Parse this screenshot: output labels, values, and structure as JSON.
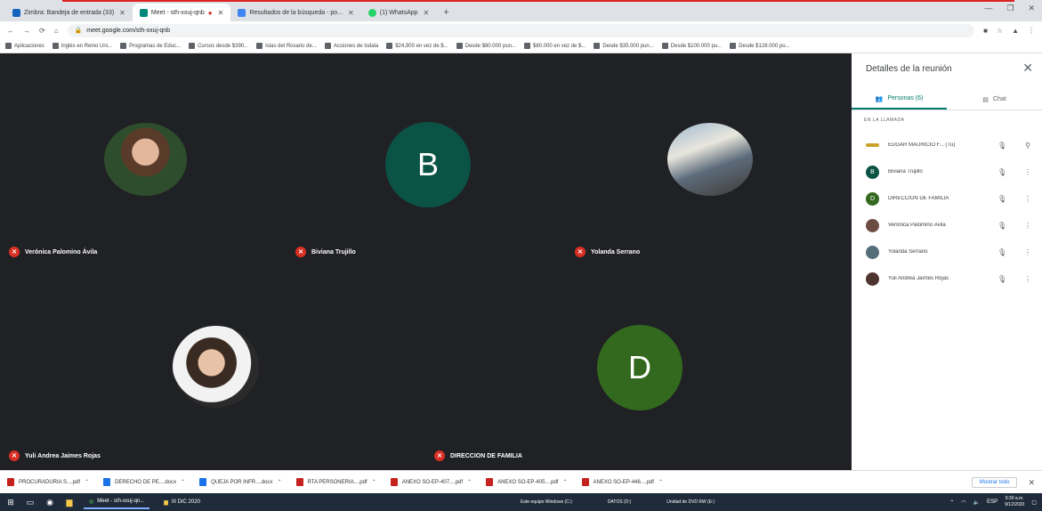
{
  "browser": {
    "tabs": [
      {
        "label": "Zimbra: Bandeja de entrada (33)",
        "active": false
      },
      {
        "label": "Meet - sth-xxuj-qnb",
        "active": true
      },
      {
        "label": "Resultados de la búsqueda - po...",
        "active": false
      },
      {
        "label": "(1) WhatsApp",
        "active": false
      }
    ],
    "new_tab": "+",
    "url": "meet.google.com/sth-xxuj-qnb",
    "bookmarks": [
      "Aplicaciones",
      "Inglés en Reino Uni...",
      "Programas de Educ...",
      "Cursos desde $390...",
      "Islas del Rosario de...",
      "Acciones de Isdala",
      "$24,900 en vez de $...",
      "Desde $80.000 pun...",
      "$80.000 en vez de $...",
      "Desde $35.000 pun...",
      "Desde $100.000 pu...",
      "Desde $128.000 pu..."
    ]
  },
  "meet": {
    "participants": [
      {
        "name": "Verónica Palomino Ávila",
        "kind": "photo",
        "photo": "photo1"
      },
      {
        "name": "Biviana Trujillo",
        "kind": "initial",
        "initial": "B",
        "color": "#0b5345"
      },
      {
        "name": "Yolanda Serrano",
        "kind": "photo",
        "photo": "photo2"
      },
      {
        "name": "Yuli Andrea Jaimes Rojas",
        "kind": "photo",
        "photo": "photo3"
      },
      {
        "name": "DIRECCION DE FAMILIA",
        "kind": "initial",
        "initial": "D",
        "color": "#33691e"
      }
    ]
  },
  "panel": {
    "title": "Detalles de la reunión",
    "tab_people": "Personas (6)",
    "tab_chat": "Chat",
    "section": "EN LA LLAMADA",
    "people": [
      {
        "name": "EDGAR MAURICIO F... (Tú)",
        "initial": "",
        "color": "#c9a227",
        "host": true
      },
      {
        "name": "Biviana Trujillo",
        "initial": "B",
        "color": "#0b5345"
      },
      {
        "name": "DIRECCION DE FAMILIA",
        "initial": "D",
        "color": "#33691e"
      },
      {
        "name": "Verónica Palomino Ávila",
        "initial": "",
        "color": "#6d4c41"
      },
      {
        "name": "Yolanda Serrano",
        "initial": "",
        "color": "#546e7a"
      },
      {
        "name": "Yuli Andrea Jaimes Rojas",
        "initial": "",
        "color": "#4e342e"
      }
    ]
  },
  "downloads": {
    "items": [
      {
        "name": "PROCURADURIA S....pdf",
        "type": "pdf"
      },
      {
        "name": "DERECHO DE PE....docx",
        "type": "doc"
      },
      {
        "name": "QUEJA POR INFR....docx",
        "type": "doc"
      },
      {
        "name": "RTA PERSONERIA....pdf",
        "type": "pdf"
      },
      {
        "name": "ANEXO SO-EP-407....pdf",
        "type": "pdf"
      },
      {
        "name": "ANEXO SO-EP-405....pdf",
        "type": "pdf"
      },
      {
        "name": "ANEXO SO-EP-446....pdf",
        "type": "pdf"
      }
    ],
    "show_all": "Mostrar todo"
  },
  "taskbar": {
    "tasks": [
      "Meet - sth-xxuj-qn...",
      "III DIC 2020"
    ],
    "mid": [
      "Este equipo  Windows (C:)",
      "DATOS (D:)",
      "Unidad de DVD RW (E:)"
    ],
    "lang": "ESP",
    "time": "9:30 a.m.",
    "date": "9/12/2020"
  }
}
